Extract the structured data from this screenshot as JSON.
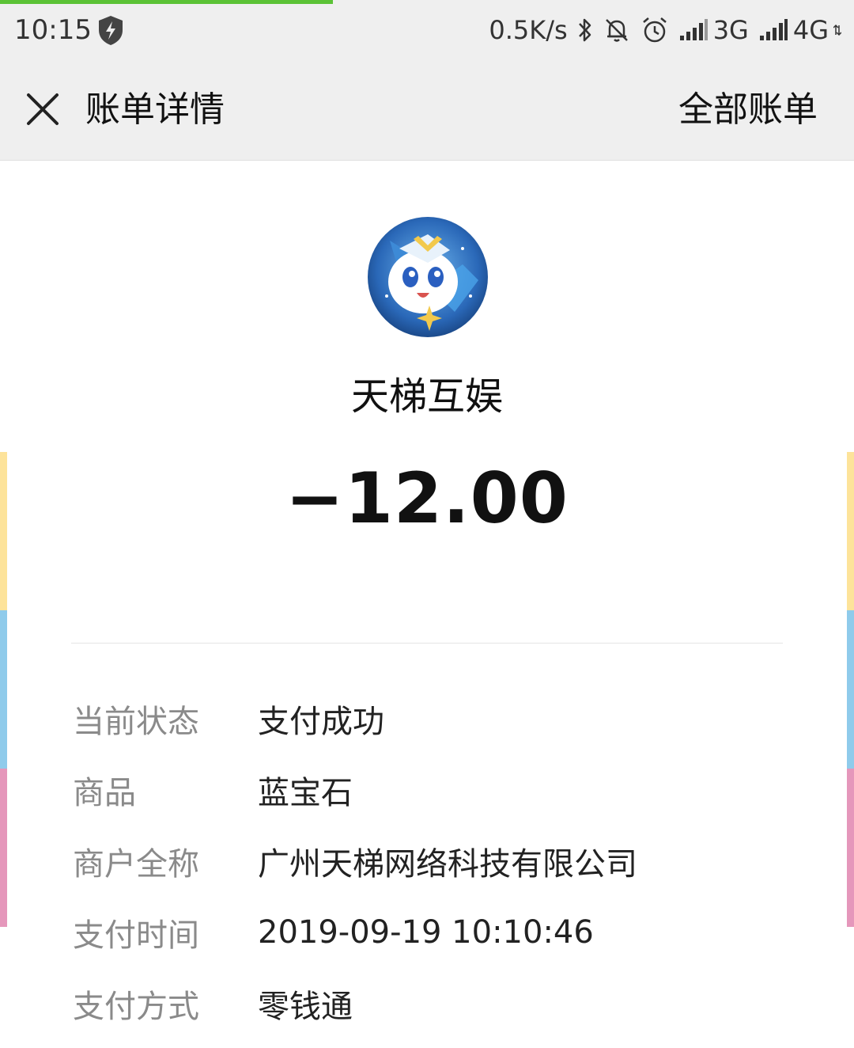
{
  "status_bar": {
    "time": "10:15",
    "net_speed": "0.5K/s",
    "network_1": "3G",
    "network_2": "4G",
    "progress": 0.39,
    "progress_color": "#5bc236"
  },
  "header": {
    "title": "账单详情",
    "all_bills": "全部账单"
  },
  "merchant": {
    "name": "天梯互娱"
  },
  "amount": "−12.00",
  "details": [
    {
      "label": "当前状态",
      "value": "支付成功"
    },
    {
      "label": "商品",
      "value": "蓝宝石"
    },
    {
      "label": "商户全称",
      "value": "广州天梯网络科技有限公司"
    },
    {
      "label": "支付时间",
      "value": "2019-09-19 10:10:46"
    },
    {
      "label": "支付方式",
      "value": "零钱通"
    }
  ],
  "colors": {
    "accent_yellow": "#fde39a",
    "accent_blue": "#8fcbeb",
    "accent_pink": "#e597bb",
    "header_bg": "#efefef"
  },
  "icons": {
    "close": "close-icon",
    "shield": "shield-bolt-icon",
    "bluetooth": "bluetooth-icon",
    "mute": "bell-off-icon",
    "alarm": "alarm-icon",
    "signal": "signal-icon"
  }
}
